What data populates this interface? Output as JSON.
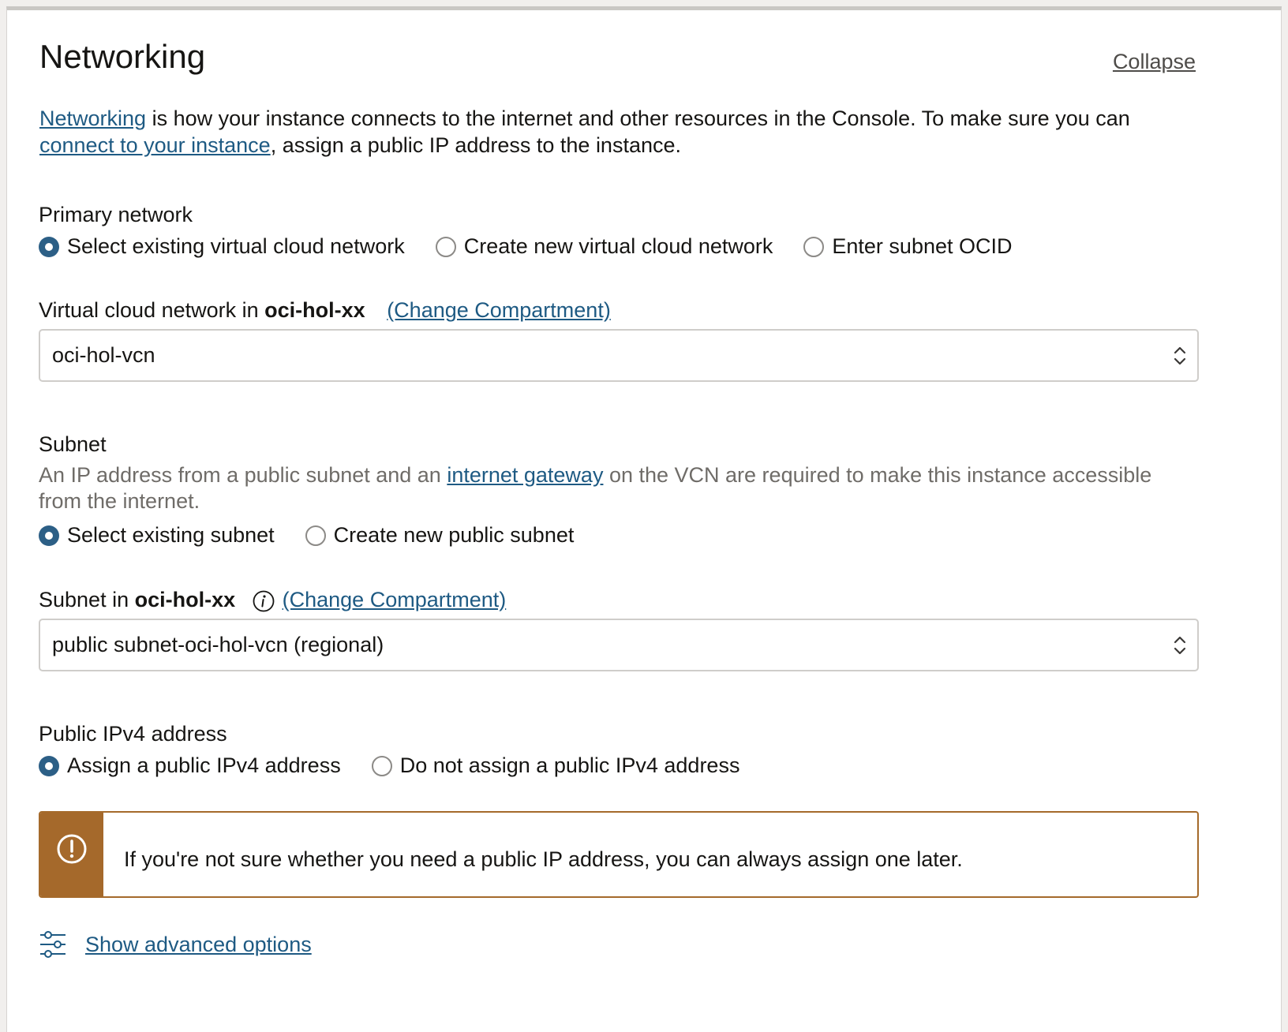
{
  "header": {
    "title": "Networking",
    "collapse_label": "Collapse"
  },
  "intro": {
    "link1": "Networking",
    "text1": " is how your instance connects to the internet and other resources in the Console. To make sure you can ",
    "link2": "connect to your instance",
    "text2": ", assign a public IP address to the instance."
  },
  "primary_network": {
    "label": "Primary network",
    "options": [
      {
        "label": "Select existing virtual cloud network",
        "selected": true
      },
      {
        "label": "Create new virtual cloud network",
        "selected": false
      },
      {
        "label": "Enter subnet OCID",
        "selected": false
      }
    ]
  },
  "vcn": {
    "label_prefix": "Virtual cloud network in ",
    "compartment": "oci-hol-xx",
    "change_compartment": "(Change Compartment)",
    "value": "oci-hol-vcn"
  },
  "subnet": {
    "label": "Subnet",
    "help_text1": "An IP address from a public subnet and an ",
    "help_link": "internet gateway",
    "help_text2": " on the VCN are required to make this instance accessible from the internet.",
    "options": [
      {
        "label": "Select existing subnet",
        "selected": true
      },
      {
        "label": "Create new public subnet",
        "selected": false
      }
    ],
    "select_label_prefix": "Subnet in ",
    "compartment": "oci-hol-xx",
    "change_compartment": "(Change Compartment)",
    "value": "public subnet-oci-hol-vcn (regional)"
  },
  "public_ipv4": {
    "label": "Public IPv4 address",
    "options": [
      {
        "label": "Assign a public IPv4 address",
        "selected": true
      },
      {
        "label": "Do not assign a public IPv4 address",
        "selected": false
      }
    ]
  },
  "warning": {
    "message": "If you're not sure whether you need a public IP address, you can always assign one later.",
    "icon": "exclamation-circle-icon",
    "color": "#a5692b"
  },
  "advanced": {
    "label": "Show advanced options",
    "icon": "sliders-icon"
  },
  "colors": {
    "link": "#1e5a83",
    "radio_selected": "#2c5f86"
  }
}
